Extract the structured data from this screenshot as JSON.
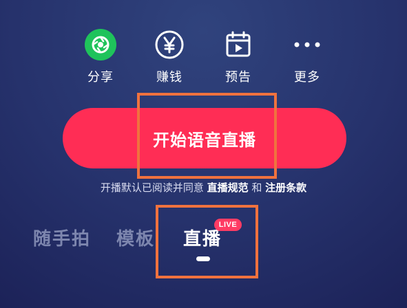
{
  "actions": [
    {
      "label": "分享",
      "icon": "share-icon"
    },
    {
      "label": "赚钱",
      "icon": "yuan-icon"
    },
    {
      "label": "预告",
      "icon": "calendar-play-icon"
    },
    {
      "label": "更多",
      "icon": "more-icon"
    }
  ],
  "start_button": {
    "label": "开始语音直播"
  },
  "agreement": {
    "prefix": "开播默认已阅读并同意 ",
    "rules_link": "直播规范",
    "conjunction": " 和 ",
    "terms_link": "注册条款"
  },
  "tabs": [
    {
      "label": "随手拍"
    },
    {
      "label": "模板"
    },
    {
      "label": "直播",
      "badge": "LIVE",
      "active": true
    }
  ],
  "colors": {
    "accent": "#ff2d55",
    "share_icon_bg": "#1fc35b",
    "highlight": "#f0723e",
    "background": "#26326c"
  }
}
